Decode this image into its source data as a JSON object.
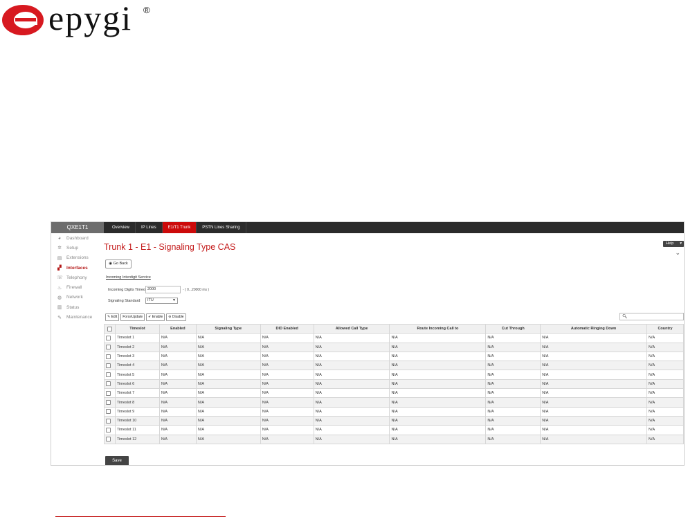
{
  "brand": {
    "logo_text": "epygi",
    "registered": "®",
    "logo_color": "#d71920"
  },
  "header": {
    "device_name": "QXE1T1",
    "tabs": [
      {
        "label": "Overview",
        "active": false
      },
      {
        "label": "IP Lines",
        "active": false
      },
      {
        "label": "E1/T1 Trunk",
        "active": true
      },
      {
        "label": "PSTN Lines Sharing",
        "active": false
      }
    ]
  },
  "sidebar": {
    "items": [
      {
        "label": "Dashboard",
        "icon": "dashboard-icon",
        "glyph": "◕",
        "active": false
      },
      {
        "label": "Setup",
        "icon": "gear-icon",
        "glyph": "✲",
        "active": false
      },
      {
        "label": "Extensions",
        "icon": "extensions-icon",
        "glyph": "▤",
        "active": false
      },
      {
        "label": "Interfaces",
        "icon": "interfaces-icon",
        "glyph": "▞",
        "active": true
      },
      {
        "label": "Telephony",
        "icon": "phone-icon",
        "glyph": "☏",
        "active": false
      },
      {
        "label": "Firewall",
        "icon": "fire-icon",
        "glyph": "♨",
        "active": false
      },
      {
        "label": "Network",
        "icon": "globe-icon",
        "glyph": "◍",
        "active": false
      },
      {
        "label": "Status",
        "icon": "chart-icon",
        "glyph": "▥",
        "active": false
      },
      {
        "label": "Maintenance",
        "icon": "wrench-icon",
        "glyph": "✎",
        "active": false
      }
    ]
  },
  "main": {
    "title": "Trunk 1 - E1 - Signaling Type CAS",
    "help_label": "Help",
    "go_back_label": "Go Back",
    "section_title": "Incoming Interdigit Service",
    "timeout_label": "Incoming Digits Timeout",
    "timeout_value": "2000",
    "timeout_range": "- ( 0...20000 ms )",
    "signaling_label": "Signaling Standard",
    "signaling_value": "ITU",
    "toolbar": {
      "edit": "Edit",
      "force_update": "ForceUpdate",
      "enable": "Enable",
      "disable": "Disable"
    },
    "search_placeholder": "",
    "save_label": "Save"
  },
  "table": {
    "columns": [
      "Timeslot",
      "Enabled",
      "Signaling Type",
      "DID Enabled",
      "Allowed Call Type",
      "Route Incoming Call to",
      "Cut Through",
      "Automatic Ringing Down",
      "Country"
    ],
    "rows": [
      [
        "Timeslot 1",
        "N/A",
        "N/A",
        "N/A",
        "N/A",
        "N/A",
        "N/A",
        "N/A",
        "N/A"
      ],
      [
        "Timeslot 2",
        "N/A",
        "N/A",
        "N/A",
        "N/A",
        "N/A",
        "N/A",
        "N/A",
        "N/A"
      ],
      [
        "Timeslot 3",
        "N/A",
        "N/A",
        "N/A",
        "N/A",
        "N/A",
        "N/A",
        "N/A",
        "N/A"
      ],
      [
        "Timeslot 4",
        "N/A",
        "N/A",
        "N/A",
        "N/A",
        "N/A",
        "N/A",
        "N/A",
        "N/A"
      ],
      [
        "Timeslot 5",
        "N/A",
        "N/A",
        "N/A",
        "N/A",
        "N/A",
        "N/A",
        "N/A",
        "N/A"
      ],
      [
        "Timeslot 6",
        "N/A",
        "N/A",
        "N/A",
        "N/A",
        "N/A",
        "N/A",
        "N/A",
        "N/A"
      ],
      [
        "Timeslot 7",
        "N/A",
        "N/A",
        "N/A",
        "N/A",
        "N/A",
        "N/A",
        "N/A",
        "N/A"
      ],
      [
        "Timeslot 8",
        "N/A",
        "N/A",
        "N/A",
        "N/A",
        "N/A",
        "N/A",
        "N/A",
        "N/A"
      ],
      [
        "Timeslot 9",
        "N/A",
        "N/A",
        "N/A",
        "N/A",
        "N/A",
        "N/A",
        "N/A",
        "N/A"
      ],
      [
        "Timeslot 10",
        "N/A",
        "N/A",
        "N/A",
        "N/A",
        "N/A",
        "N/A",
        "N/A",
        "N/A"
      ],
      [
        "Timeslot 11",
        "N/A",
        "N/A",
        "N/A",
        "N/A",
        "N/A",
        "N/A",
        "N/A",
        "N/A"
      ],
      [
        "Timeslot 12",
        "N/A",
        "N/A",
        "N/A",
        "N/A",
        "N/A",
        "N/A",
        "N/A",
        "N/A"
      ]
    ]
  },
  "colors": {
    "accent": "#cc0a0a",
    "topbar": "#2b2b2b",
    "title": "#c41a1a"
  }
}
